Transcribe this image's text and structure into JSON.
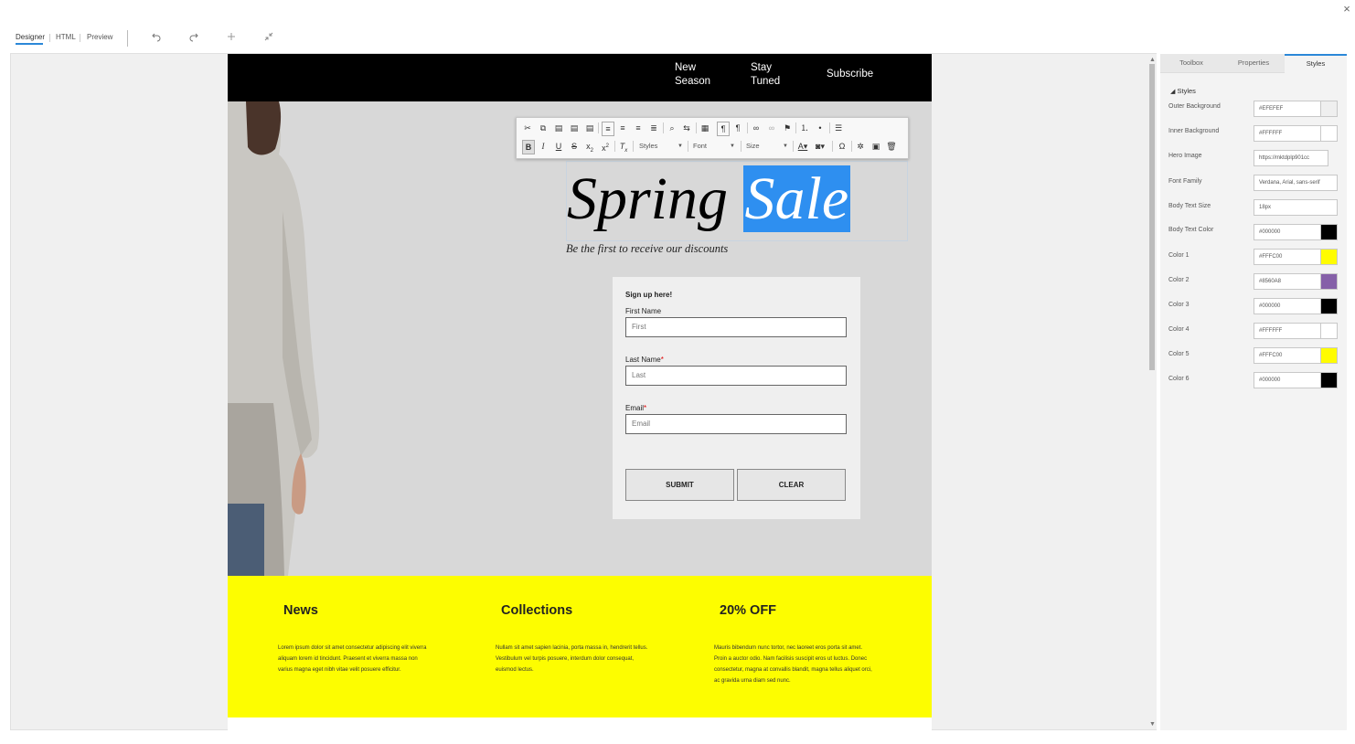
{
  "window": {
    "close_glyph": "×"
  },
  "view_tabs": {
    "designer": "Designer",
    "html": "HTML",
    "preview": "Preview"
  },
  "toolbar_icons": [
    "undo-icon",
    "redo-icon",
    "add-icon",
    "collapse-icon"
  ],
  "email": {
    "nav": {
      "new_season_1": "New",
      "new_season_2": "Season",
      "stay_tuned_1": "Stay",
      "stay_tuned_2": "Tuned",
      "subscribe": "Subscribe"
    },
    "hero": {
      "title_plain": "Spring ",
      "title_selected": "Sale",
      "subtitle": "Be the first to receive our discounts"
    },
    "rte": {
      "styles": "Styles",
      "font": "Font",
      "size": "Size"
    },
    "form": {
      "heading": "Sign up here!",
      "first_label": "First Name",
      "first_placeholder": "First",
      "last_label": "Last Name",
      "last_placeholder": "Last",
      "email_label": "Email",
      "email_placeholder": "Email",
      "required_mark": "*",
      "submit": "SUBMIT",
      "clear": "CLEAR"
    },
    "columns": [
      {
        "title": "News",
        "body": "Lorem ipsum dolor sit amet consectetur adipiscing elit viverra aliquam lorem id tincidunt. Praesent et viverra massa non varius magna eget nibh vitae velit posuere efficitur."
      },
      {
        "title": "Collections",
        "body": "Nullam sit amet sapien lacinia, porta massa in, hendrerit tellus. Vestibulum vel turpis posuere, interdum dolor consequat, euismod lectus."
      },
      {
        "title": "20% OFF",
        "body": "Mauris bibendum nunc tortor, nec laoreet eros porta sit amet. Proin a auctor odio. Nam facilisis suscipit eros ut luctus. Donec consectetur, magna at convallis blandit, magna tellus aliquet orci, ac gravida urna diam sed nunc."
      }
    ],
    "colors": {
      "nav_bg": "#000000",
      "hero_bg": "#D8D8D8",
      "yellow": "#FDFD00",
      "selection": "#2E8FF0"
    }
  },
  "panel": {
    "tabs": {
      "toolbox": "Toolbox",
      "properties": "Properties",
      "styles": "Styles"
    },
    "heading": "Styles",
    "props": [
      {
        "label": "Outer Background",
        "value": "#EFEFEF",
        "swatch": "#EFEFEF"
      },
      {
        "label": "Inner Background",
        "value": "#FFFFFF",
        "swatch": "#FFFFFF"
      },
      {
        "label": "Hero Image",
        "value": "https://mktdplp901cc"
      },
      {
        "label": "Font Family",
        "value": "Verdana, Arial, sans-serif"
      },
      {
        "label": "Body Text Size",
        "value": "18px"
      },
      {
        "label": "Body Text Color",
        "value": "#000000",
        "swatch": "#000000"
      },
      {
        "label": "Color 1",
        "value": "#FFFC00",
        "swatch": "#FFFC00"
      },
      {
        "label": "Color 2",
        "value": "#8560A8",
        "swatch": "#8560A8"
      },
      {
        "label": "Color 3",
        "value": "#000000",
        "swatch": "#000000"
      },
      {
        "label": "Color 4",
        "value": "#FFFFFF",
        "swatch": "#FFFFFF"
      },
      {
        "label": "Color 5",
        "value": "#FFFC00",
        "swatch": "#FFFC00"
      },
      {
        "label": "Color 6",
        "value": "#000000",
        "swatch": "#000000"
      }
    ]
  }
}
